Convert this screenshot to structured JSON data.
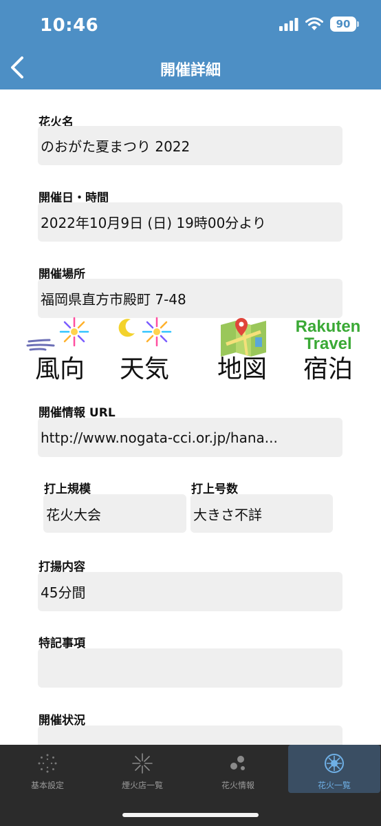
{
  "status": {
    "time": "10:46",
    "battery": "90"
  },
  "header": {
    "title": "開催詳細"
  },
  "fields": {
    "name": {
      "label": "花火名",
      "value": "のおがた夏まつり 2022"
    },
    "datetime": {
      "label": "開催日・時間",
      "value": "2022年10月9日 (日) 19時00分より"
    },
    "place": {
      "label": "開催場所",
      "value": "福岡県直方市殿町 7-48"
    },
    "url": {
      "label": "開催情報 URL",
      "value": "http://www.nogata-cci.or.jp/hana..."
    },
    "scale": {
      "label": "打上規模",
      "value": "花火大会"
    },
    "count": {
      "label": "打上号数",
      "value": "大きさ不詳"
    },
    "content": {
      "label": "打揚内容",
      "value": "45分間"
    },
    "notes": {
      "label": "特記事項",
      "value": ""
    },
    "status": {
      "label": "開催状況",
      "value": ""
    }
  },
  "shortcuts": [
    {
      "label": "風向",
      "icon": "wind-icon"
    },
    {
      "label": "天気",
      "icon": "weather-icon"
    },
    {
      "label": "地図",
      "icon": "map-icon"
    },
    {
      "label": "宿泊",
      "icon": "rakuten-travel-icon",
      "logo_line1": "Rakuten",
      "logo_line2": "Travel"
    }
  ],
  "tabs": [
    {
      "label": "基本設定",
      "active": false
    },
    {
      "label": "煙火店一覧",
      "active": false
    },
    {
      "label": "花火情報",
      "active": false
    },
    {
      "label": "花火一覧",
      "active": true
    }
  ],
  "colors": {
    "header": "#4d8fc5",
    "field_bg": "#efefef",
    "tabbar": "#2b2b2b",
    "tab_active": "#6fb0e6",
    "rakuten_green": "#3aa935"
  }
}
